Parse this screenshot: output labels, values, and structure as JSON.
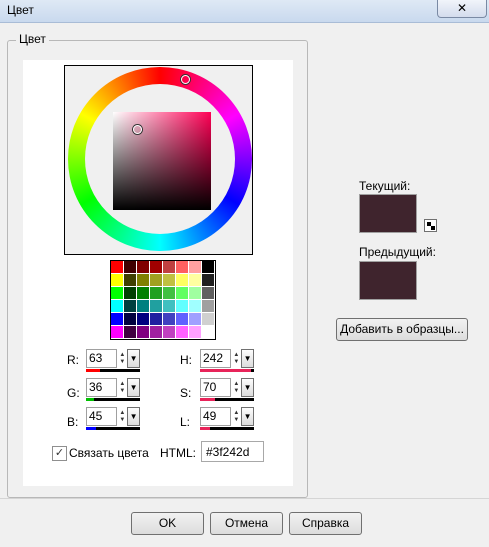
{
  "window": {
    "title": "Цвет",
    "close_glyph": "✕"
  },
  "group": {
    "label": "Цвет"
  },
  "swatch_colors": [
    "#ff0000",
    "#400000",
    "#800000",
    "#a00000",
    "#c04040",
    "#ff6060",
    "#ffa0a0",
    "#000000",
    "#ffff00",
    "#404000",
    "#808000",
    "#a0a020",
    "#c0c040",
    "#ffff60",
    "#ffffa0",
    "#202020",
    "#00ff00",
    "#004000",
    "#008000",
    "#20a020",
    "#40c040",
    "#60ff60",
    "#a0ffa0",
    "#606060",
    "#00ffff",
    "#004040",
    "#008080",
    "#20a0a0",
    "#40c0c0",
    "#60ffff",
    "#a0ffff",
    "#a0a0a0",
    "#0000ff",
    "#000040",
    "#000080",
    "#2020a0",
    "#4040c0",
    "#6060ff",
    "#a0a0ff",
    "#d0d0d0",
    "#ff00ff",
    "#400040",
    "#800080",
    "#a020a0",
    "#c040c0",
    "#ff60ff",
    "#ffa0ff",
    "#ffffff"
  ],
  "rgb": {
    "r_label": "R:",
    "r_value": "63",
    "g_label": "G:",
    "g_value": "36",
    "b_label": "B:",
    "b_value": "45"
  },
  "hsl": {
    "h_label": "H:",
    "h_value": "242",
    "s_label": "S:",
    "s_value": "70",
    "l_label": "L:",
    "l_value": "49"
  },
  "bars": {
    "r_fraction": 0.25,
    "g_fraction": 0.14,
    "b_fraction": 0.18,
    "h_fraction": 0.95,
    "s_fraction": 0.27,
    "l_fraction": 0.19,
    "r_color": "#ff0000",
    "g_color": "#00c000",
    "b_color": "#0000ff",
    "h_color": "#e8245a",
    "s_color": "#e8245a",
    "l_color": "#e8245a"
  },
  "link_colors": {
    "label": "Связать цвета",
    "checked": true,
    "check_glyph": "✓"
  },
  "html": {
    "label": "HTML:",
    "value": "#3f242d"
  },
  "current": {
    "label": "Текущий:",
    "color": "#3f242d"
  },
  "previous": {
    "label": "Предыдущий:",
    "color": "#3f242d"
  },
  "add_to_swatches": "Добавить в образцы...",
  "buttons": {
    "ok": "OK",
    "cancel": "Отмена",
    "help": "Справка"
  },
  "icons": {
    "spin_up": "▲",
    "spin_down": "▼",
    "dropdown": "▼"
  }
}
